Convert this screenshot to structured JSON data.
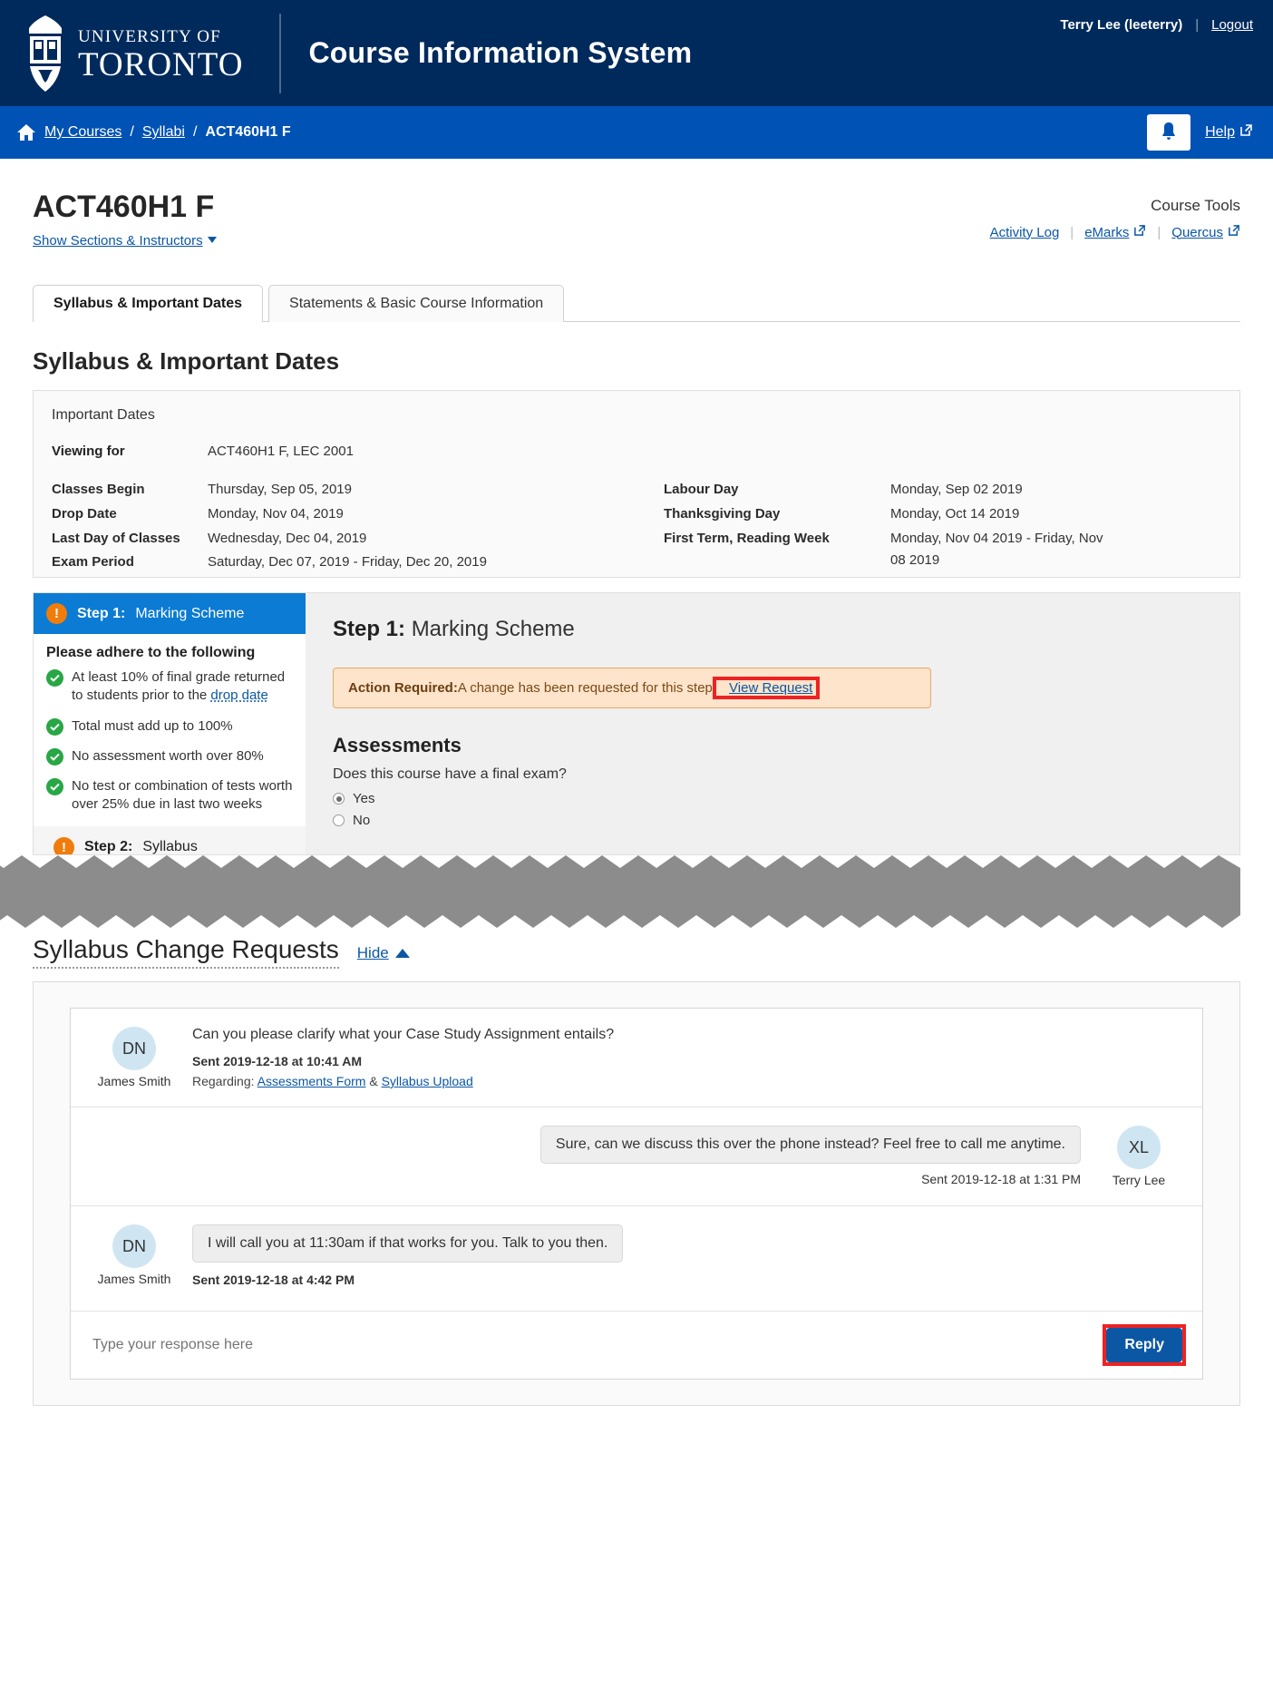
{
  "header": {
    "university_line1": "UNIVERSITY OF",
    "university_line2": "TORONTO",
    "app_title": "Course Information System",
    "user_name": "Terry Lee (leeterry)",
    "separator": "|",
    "logout_label": "Logout"
  },
  "breadcrumb": {
    "home_icon": "home-icon",
    "items": [
      {
        "label": "My Courses",
        "link": true
      },
      {
        "label": "Syllabi",
        "link": true
      },
      {
        "label": "ACT460H1 F",
        "link": false
      }
    ],
    "slash": "/",
    "bell_icon": "bell-icon",
    "help_label": "Help",
    "help_icon": "external-link-icon"
  },
  "course": {
    "code": "ACT460H1 F",
    "show_sections_label": "Show Sections & Instructors"
  },
  "course_tools": {
    "title": "Course Tools",
    "links": [
      {
        "label": "Activity Log",
        "external": false
      },
      {
        "label": "eMarks",
        "external": true
      },
      {
        "label": "Quercus",
        "external": true
      }
    ]
  },
  "tabs": [
    {
      "label": "Syllabus & Important Dates",
      "active": true
    },
    {
      "label": "Statements & Basic Course Information",
      "active": false
    }
  ],
  "section_heading": "Syllabus & Important Dates",
  "important_dates": {
    "card_title": "Important Dates",
    "viewing_for_label": "Viewing for",
    "viewing_for_value": "ACT460H1 F, LEC 2001",
    "left": [
      {
        "label": "Classes Begin",
        "value": "Thursday, Sep 05, 2019"
      },
      {
        "label": "Drop Date",
        "value": "Monday, Nov 04, 2019"
      },
      {
        "label": "Last Day of Classes",
        "value": "Wednesday, Dec 04, 2019"
      },
      {
        "label": "Exam Period",
        "value": "Saturday, Dec 07, 2019 - Friday, Dec 20, 2019"
      }
    ],
    "right": [
      {
        "label": "Labour Day",
        "value": "Monday, Sep 02 2019"
      },
      {
        "label": "Thanksgiving Day",
        "value": "Monday, Oct 14 2019"
      },
      {
        "label": "First Term, Reading Week",
        "value": "Monday, Nov 04 2019 - Friday, Nov 08 2019"
      }
    ]
  },
  "step_sidebar": {
    "step1_prefix": "Step 1:",
    "step1_name": "Marking Scheme",
    "adhere_title": "Please adhere to the following",
    "rules": [
      {
        "text_before": "At least 10% of final grade returned to students prior to the ",
        "link": "drop date",
        "text_after": ""
      },
      {
        "text_before": "Total must add up to 100%",
        "link": "",
        "text_after": ""
      },
      {
        "text_before": "No assessment worth over 80%",
        "link": "",
        "text_after": ""
      },
      {
        "text_before": "No test or combination of tests worth over 25% due in last two weeks",
        "link": "",
        "text_after": ""
      }
    ],
    "step2_prefix": "Step 2:",
    "step2_name": "Syllabus"
  },
  "step_main": {
    "title_prefix": "Step 1:",
    "title_name": "Marking Scheme",
    "alert_bold": "Action Required:",
    "alert_text": " A change has been requested for this step.",
    "alert_link": "View Request",
    "assessments_heading": "Assessments",
    "question": "Does this course have a final exam?",
    "options": [
      {
        "label": "Yes",
        "selected": true
      },
      {
        "label": "No",
        "selected": false
      }
    ]
  },
  "change_requests": {
    "heading": "Syllabus Change Requests",
    "hide_label": "Hide",
    "messages": [
      {
        "side": "left",
        "initials": "DN",
        "name": "James Smith",
        "text": "Can you please clarify what your Case Study Assignment entails?",
        "sent": "Sent 2019-12-18 at 10:41 AM",
        "regarding_label": "Regarding:",
        "regarding_links": [
          "Assessments Form",
          "Syllabus Upload"
        ],
        "regarding_joiner": "&"
      },
      {
        "side": "right",
        "initials": "XL",
        "name": "Terry Lee",
        "text": "Sure, can we discuss this over the phone instead? Feel free to call me anytime.",
        "sent": "Sent 2019-12-18 at 1:31 PM"
      },
      {
        "side": "left-bubble",
        "initials": "DN",
        "name": "James Smith",
        "text": "I will call you at 11:30am if that works for you. Talk to you then.",
        "sent": "Sent 2019-12-18 at 4:42 PM"
      }
    ],
    "composer_placeholder": "Type your response here",
    "reply_label": "Reply"
  },
  "colors": {
    "header_navy": "#002a5c",
    "crumb_blue": "#0052b4",
    "link_blue": "#0b57a4",
    "step_blue": "#0b7bd4",
    "warn_orange": "#f07c0b",
    "check_green": "#27a745",
    "alert_bg": "#fde4cb",
    "alert_border": "#e8a96a",
    "highlight_red": "#ee2222"
  }
}
